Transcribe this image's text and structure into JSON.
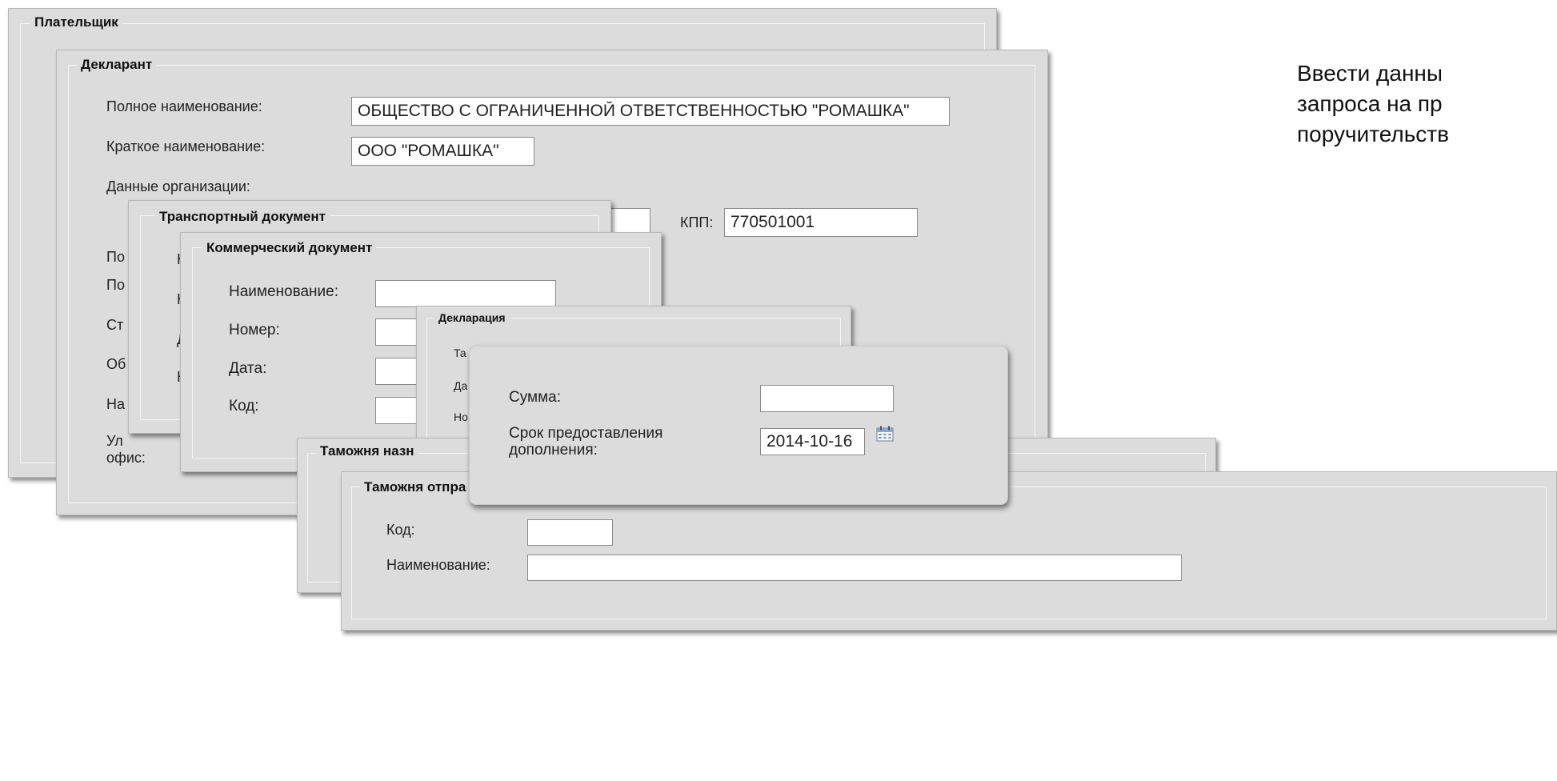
{
  "instruction": {
    "line1": "Ввести данны",
    "line2": "запроса на пр",
    "line3": "поручительств"
  },
  "payer": {
    "title": "Плательщик"
  },
  "declarant": {
    "title": "Декларант",
    "full_name_label": "Полное наименование:",
    "full_name_value": "ОБЩЕСТВО С ОГРАНИЧЕННОЙ ОТВЕТСТВЕННОСТЬЮ \"РОМАШКА\"",
    "short_name_label": "Краткое наименование:",
    "short_name_value": "ООО \"РОМАШКА\"",
    "org_data_label": "Данные организации:",
    "kpp_label": "КПП:",
    "kpp_value": "770501001",
    "partial_labels": [
      "По",
      "По",
      "Ст",
      "Об",
      "На"
    ],
    "office_label_line1": "Ул",
    "office_label_line2": "офис:"
  },
  "transport_doc": {
    "title": "Транспортный документ",
    "partial_labels": [
      "Н",
      "Н",
      "Д",
      "Н"
    ]
  },
  "commercial_doc": {
    "title": "Коммерческий документ",
    "name_label": "Наименование:",
    "number_label": "Номер:",
    "date_label": "Дата:",
    "code_label": "Код:"
  },
  "declaration": {
    "title": "Декларация",
    "partial_labels": [
      "Та",
      "Да",
      "Но"
    ]
  },
  "customs_dest": {
    "title": "Таможня назн"
  },
  "customs_depart": {
    "title": "Таможня отпра",
    "code_label": "Код:",
    "name_label": "Наименование:"
  },
  "sum_popup": {
    "sum_label": "Сумма:",
    "sum_value": "",
    "deadline_label_line1": "Срок предоставления",
    "deadline_label_line2": "дополнения:",
    "deadline_value": "2014-10-16",
    "calendar_icon": "calendar-icon"
  }
}
